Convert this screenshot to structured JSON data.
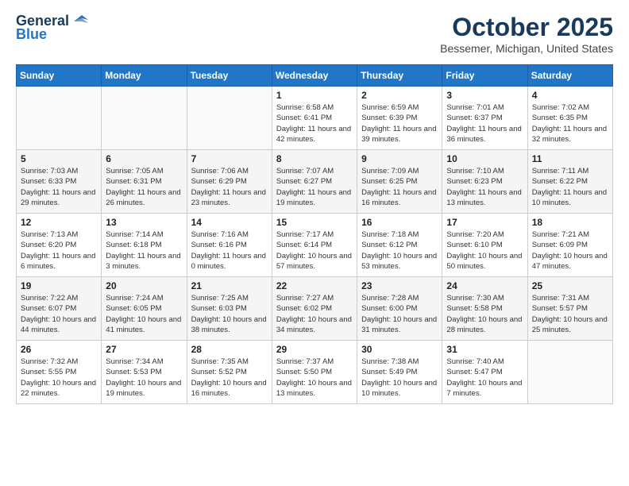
{
  "header": {
    "logo_general": "General",
    "logo_blue": "Blue",
    "month_title": "October 2025",
    "location": "Bessemer, Michigan, United States"
  },
  "days_of_week": [
    "Sunday",
    "Monday",
    "Tuesday",
    "Wednesday",
    "Thursday",
    "Friday",
    "Saturday"
  ],
  "weeks": [
    [
      {
        "day": "",
        "sunrise": "",
        "sunset": "",
        "daylight": ""
      },
      {
        "day": "",
        "sunrise": "",
        "sunset": "",
        "daylight": ""
      },
      {
        "day": "",
        "sunrise": "",
        "sunset": "",
        "daylight": ""
      },
      {
        "day": "1",
        "sunrise": "Sunrise: 6:58 AM",
        "sunset": "Sunset: 6:41 PM",
        "daylight": "Daylight: 11 hours and 42 minutes."
      },
      {
        "day": "2",
        "sunrise": "Sunrise: 6:59 AM",
        "sunset": "Sunset: 6:39 PM",
        "daylight": "Daylight: 11 hours and 39 minutes."
      },
      {
        "day": "3",
        "sunrise": "Sunrise: 7:01 AM",
        "sunset": "Sunset: 6:37 PM",
        "daylight": "Daylight: 11 hours and 36 minutes."
      },
      {
        "day": "4",
        "sunrise": "Sunrise: 7:02 AM",
        "sunset": "Sunset: 6:35 PM",
        "daylight": "Daylight: 11 hours and 32 minutes."
      }
    ],
    [
      {
        "day": "5",
        "sunrise": "Sunrise: 7:03 AM",
        "sunset": "Sunset: 6:33 PM",
        "daylight": "Daylight: 11 hours and 29 minutes."
      },
      {
        "day": "6",
        "sunrise": "Sunrise: 7:05 AM",
        "sunset": "Sunset: 6:31 PM",
        "daylight": "Daylight: 11 hours and 26 minutes."
      },
      {
        "day": "7",
        "sunrise": "Sunrise: 7:06 AM",
        "sunset": "Sunset: 6:29 PM",
        "daylight": "Daylight: 11 hours and 23 minutes."
      },
      {
        "day": "8",
        "sunrise": "Sunrise: 7:07 AM",
        "sunset": "Sunset: 6:27 PM",
        "daylight": "Daylight: 11 hours and 19 minutes."
      },
      {
        "day": "9",
        "sunrise": "Sunrise: 7:09 AM",
        "sunset": "Sunset: 6:25 PM",
        "daylight": "Daylight: 11 hours and 16 minutes."
      },
      {
        "day": "10",
        "sunrise": "Sunrise: 7:10 AM",
        "sunset": "Sunset: 6:23 PM",
        "daylight": "Daylight: 11 hours and 13 minutes."
      },
      {
        "day": "11",
        "sunrise": "Sunrise: 7:11 AM",
        "sunset": "Sunset: 6:22 PM",
        "daylight": "Daylight: 11 hours and 10 minutes."
      }
    ],
    [
      {
        "day": "12",
        "sunrise": "Sunrise: 7:13 AM",
        "sunset": "Sunset: 6:20 PM",
        "daylight": "Daylight: 11 hours and 6 minutes."
      },
      {
        "day": "13",
        "sunrise": "Sunrise: 7:14 AM",
        "sunset": "Sunset: 6:18 PM",
        "daylight": "Daylight: 11 hours and 3 minutes."
      },
      {
        "day": "14",
        "sunrise": "Sunrise: 7:16 AM",
        "sunset": "Sunset: 6:16 PM",
        "daylight": "Daylight: 11 hours and 0 minutes."
      },
      {
        "day": "15",
        "sunrise": "Sunrise: 7:17 AM",
        "sunset": "Sunset: 6:14 PM",
        "daylight": "Daylight: 10 hours and 57 minutes."
      },
      {
        "day": "16",
        "sunrise": "Sunrise: 7:18 AM",
        "sunset": "Sunset: 6:12 PM",
        "daylight": "Daylight: 10 hours and 53 minutes."
      },
      {
        "day": "17",
        "sunrise": "Sunrise: 7:20 AM",
        "sunset": "Sunset: 6:10 PM",
        "daylight": "Daylight: 10 hours and 50 minutes."
      },
      {
        "day": "18",
        "sunrise": "Sunrise: 7:21 AM",
        "sunset": "Sunset: 6:09 PM",
        "daylight": "Daylight: 10 hours and 47 minutes."
      }
    ],
    [
      {
        "day": "19",
        "sunrise": "Sunrise: 7:22 AM",
        "sunset": "Sunset: 6:07 PM",
        "daylight": "Daylight: 10 hours and 44 minutes."
      },
      {
        "day": "20",
        "sunrise": "Sunrise: 7:24 AM",
        "sunset": "Sunset: 6:05 PM",
        "daylight": "Daylight: 10 hours and 41 minutes."
      },
      {
        "day": "21",
        "sunrise": "Sunrise: 7:25 AM",
        "sunset": "Sunset: 6:03 PM",
        "daylight": "Daylight: 10 hours and 38 minutes."
      },
      {
        "day": "22",
        "sunrise": "Sunrise: 7:27 AM",
        "sunset": "Sunset: 6:02 PM",
        "daylight": "Daylight: 10 hours and 34 minutes."
      },
      {
        "day": "23",
        "sunrise": "Sunrise: 7:28 AM",
        "sunset": "Sunset: 6:00 PM",
        "daylight": "Daylight: 10 hours and 31 minutes."
      },
      {
        "day": "24",
        "sunrise": "Sunrise: 7:30 AM",
        "sunset": "Sunset: 5:58 PM",
        "daylight": "Daylight: 10 hours and 28 minutes."
      },
      {
        "day": "25",
        "sunrise": "Sunrise: 7:31 AM",
        "sunset": "Sunset: 5:57 PM",
        "daylight": "Daylight: 10 hours and 25 minutes."
      }
    ],
    [
      {
        "day": "26",
        "sunrise": "Sunrise: 7:32 AM",
        "sunset": "Sunset: 5:55 PM",
        "daylight": "Daylight: 10 hours and 22 minutes."
      },
      {
        "day": "27",
        "sunrise": "Sunrise: 7:34 AM",
        "sunset": "Sunset: 5:53 PM",
        "daylight": "Daylight: 10 hours and 19 minutes."
      },
      {
        "day": "28",
        "sunrise": "Sunrise: 7:35 AM",
        "sunset": "Sunset: 5:52 PM",
        "daylight": "Daylight: 10 hours and 16 minutes."
      },
      {
        "day": "29",
        "sunrise": "Sunrise: 7:37 AM",
        "sunset": "Sunset: 5:50 PM",
        "daylight": "Daylight: 10 hours and 13 minutes."
      },
      {
        "day": "30",
        "sunrise": "Sunrise: 7:38 AM",
        "sunset": "Sunset: 5:49 PM",
        "daylight": "Daylight: 10 hours and 10 minutes."
      },
      {
        "day": "31",
        "sunrise": "Sunrise: 7:40 AM",
        "sunset": "Sunset: 5:47 PM",
        "daylight": "Daylight: 10 hours and 7 minutes."
      },
      {
        "day": "",
        "sunrise": "",
        "sunset": "",
        "daylight": ""
      }
    ]
  ]
}
